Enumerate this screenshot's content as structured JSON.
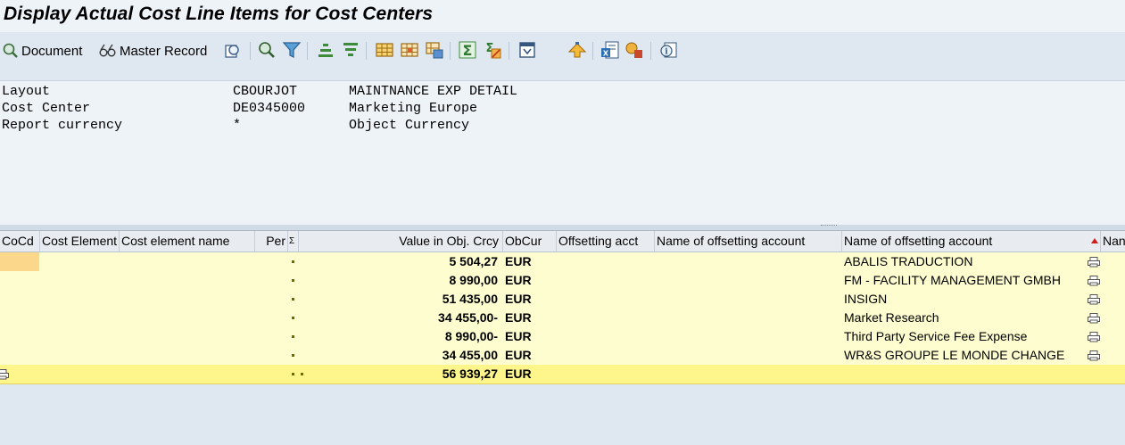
{
  "window": {
    "title": "Display Actual Cost Line Items for Cost Centers"
  },
  "toolbar": {
    "document_label": "Document",
    "master_record_label": "Master Record",
    "icons": [
      "choose-detail-icon",
      "find-icon",
      "filter-icon",
      "sort-ascending-icon",
      "sort-descending-icon",
      "layout-icon",
      "change-layout-icon",
      "save-layout-icon",
      "total-icon",
      "subtotal-icon",
      "export-icon",
      "send-icon",
      "excel-icon",
      "abc-analysis-icon",
      "info-icon"
    ]
  },
  "header": {
    "rows": [
      {
        "label": "Layout",
        "value": "CBOURJOT",
        "desc": "MAINTNANCE EXP DETAIL"
      },
      {
        "label": "Cost Center",
        "value": "DE0345000",
        "desc": "Marketing Europe"
      },
      {
        "label": "Report currency",
        "value": "*",
        "desc": "Object Currency"
      }
    ]
  },
  "grid": {
    "columns": {
      "cocd": "CoCd",
      "cost_element": "Cost Element",
      "cost_element_name": "Cost element name",
      "per": "Per",
      "sigma": "Σ",
      "value": "Value in Obj. Crcy",
      "obcur": "ObCur",
      "offsetting_acct": "Offsetting acct",
      "name_offsetting_1": "Name of offsetting account",
      "name_offsetting_2": "Name of offsetting account",
      "name_offsetting_3": "Nan"
    },
    "rows": [
      {
        "value": "5 504,27",
        "currency": "EUR",
        "offset_name": "ABALIS TRADUCTION"
      },
      {
        "value": "8 990,00",
        "currency": "EUR",
        "offset_name": "FM - FACILITY MANAGEMENT GMBH"
      },
      {
        "value": "51 435,00",
        "currency": "EUR",
        "offset_name": "INSIGN"
      },
      {
        "value": "34 455,00-",
        "currency": "EUR",
        "offset_name": "Market Research"
      },
      {
        "value": "8 990,00-",
        "currency": "EUR",
        "offset_name": "Third Party Service Fee Expense"
      },
      {
        "value": "34 455,00",
        "currency": "EUR",
        "offset_name": "WR&S GROUPE LE MONDE CHANGE"
      }
    ],
    "total": {
      "value": "56 939,27",
      "currency": "EUR"
    }
  },
  "colors": {
    "row_bg": "#fefdcf",
    "total_bg": "#fef58b",
    "selected_cell": "#fbd78b",
    "background": "#dfe8f1"
  }
}
